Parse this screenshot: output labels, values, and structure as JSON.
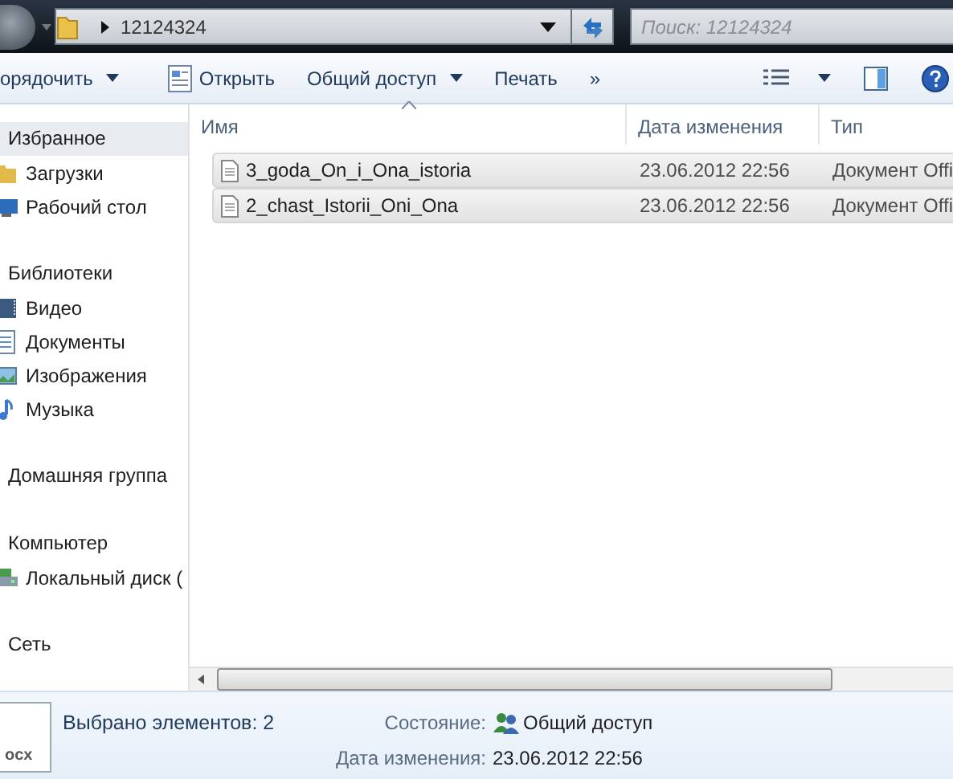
{
  "address": {
    "path": "12124324"
  },
  "search": {
    "placeholder": "Поиск: 12124324"
  },
  "toolbar": [
    {
      "kind": "menu",
      "label": "орядочить"
    },
    {
      "kind": "open",
      "label": "Открыть"
    },
    {
      "kind": "menu",
      "label": "Общий доступ"
    },
    {
      "kind": "plain",
      "label": "Печать"
    },
    {
      "kind": "plain",
      "label": "»"
    }
  ],
  "sidebar": {
    "groups": [
      {
        "label": "Избранное",
        "selected": true,
        "children": [
          {
            "label": "Загрузки",
            "kind": "folder",
            "selected": false
          },
          {
            "label": "Рабочий стол",
            "kind": "desktop",
            "selected": false
          }
        ]
      },
      {
        "label": "Библиотеки",
        "selected": false,
        "children": [
          {
            "label": "Видео",
            "kind": "video",
            "selected": false
          },
          {
            "label": "Документы",
            "kind": "documents",
            "selected": false
          },
          {
            "label": "Изображения",
            "kind": "pictures",
            "selected": false
          },
          {
            "label": "Музыка",
            "kind": "music",
            "selected": false
          }
        ]
      },
      {
        "label": "Домашняя группа",
        "selected": false
      },
      {
        "label": "Компьютер",
        "selected": false,
        "children": [
          {
            "label": "Локальный диск (",
            "kind": "drive",
            "selected": false
          }
        ]
      },
      {
        "label": "Сеть",
        "selected": false
      }
    ]
  },
  "table": {
    "columns": [
      {
        "label": "Имя",
        "sorted": true
      },
      {
        "label": "Дата изменения",
        "sorted": false
      },
      {
        "label": "Тип",
        "sorted": false
      }
    ],
    "rows": [
      {
        "name": "3_goda_On_i_Ona_istoria",
        "date": "23.06.2012 22:56",
        "type": "Документ Offi",
        "selected": true
      },
      {
        "name": "2_chast_Istorii_Oni_Ona",
        "date": "23.06.2012 22:56",
        "type": "Документ Offi",
        "selected": true
      }
    ]
  },
  "status_bar": {
    "thumb_label": "ocx",
    "selection": "Выбрано элементов: 2",
    "fields": [
      {
        "label": "Состояние:",
        "value": "Общий доступ",
        "kind": "shared"
      },
      {
        "label": "Дата изменения:",
        "value": "23.06.2012 22:56",
        "kind": "plain"
      }
    ]
  }
}
